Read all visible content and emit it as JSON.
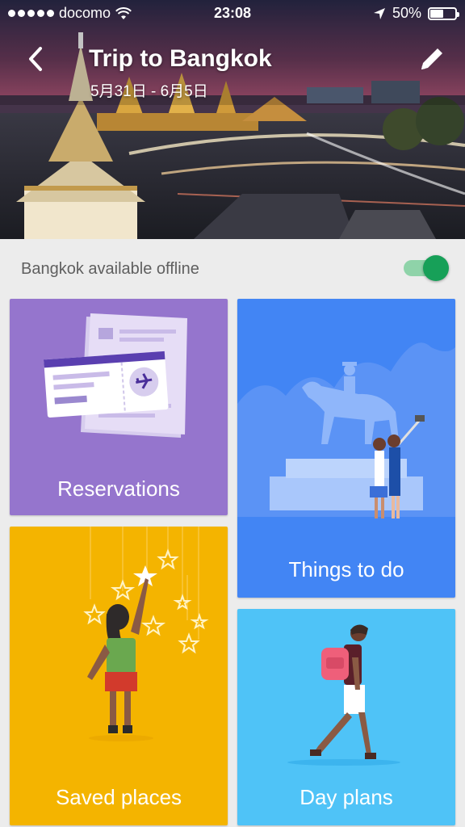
{
  "status_bar": {
    "carrier": "docomo",
    "time": "23:08",
    "battery": "50%"
  },
  "header": {
    "title": "Trip to Bangkok",
    "dates": "5月31日 - 6月5日"
  },
  "offline": {
    "label": "Bangkok available offline",
    "enabled": true
  },
  "cards": {
    "reservations": "Reservations",
    "things_to_do": "Things to do",
    "saved_places": "Saved places",
    "day_plans": "Day plans"
  },
  "colors": {
    "reservations": "#9575cd",
    "things_to_do": "#4285f4",
    "saved_places": "#f4b400",
    "day_plans": "#4fc3f7",
    "toggle_on": "#17a058"
  }
}
